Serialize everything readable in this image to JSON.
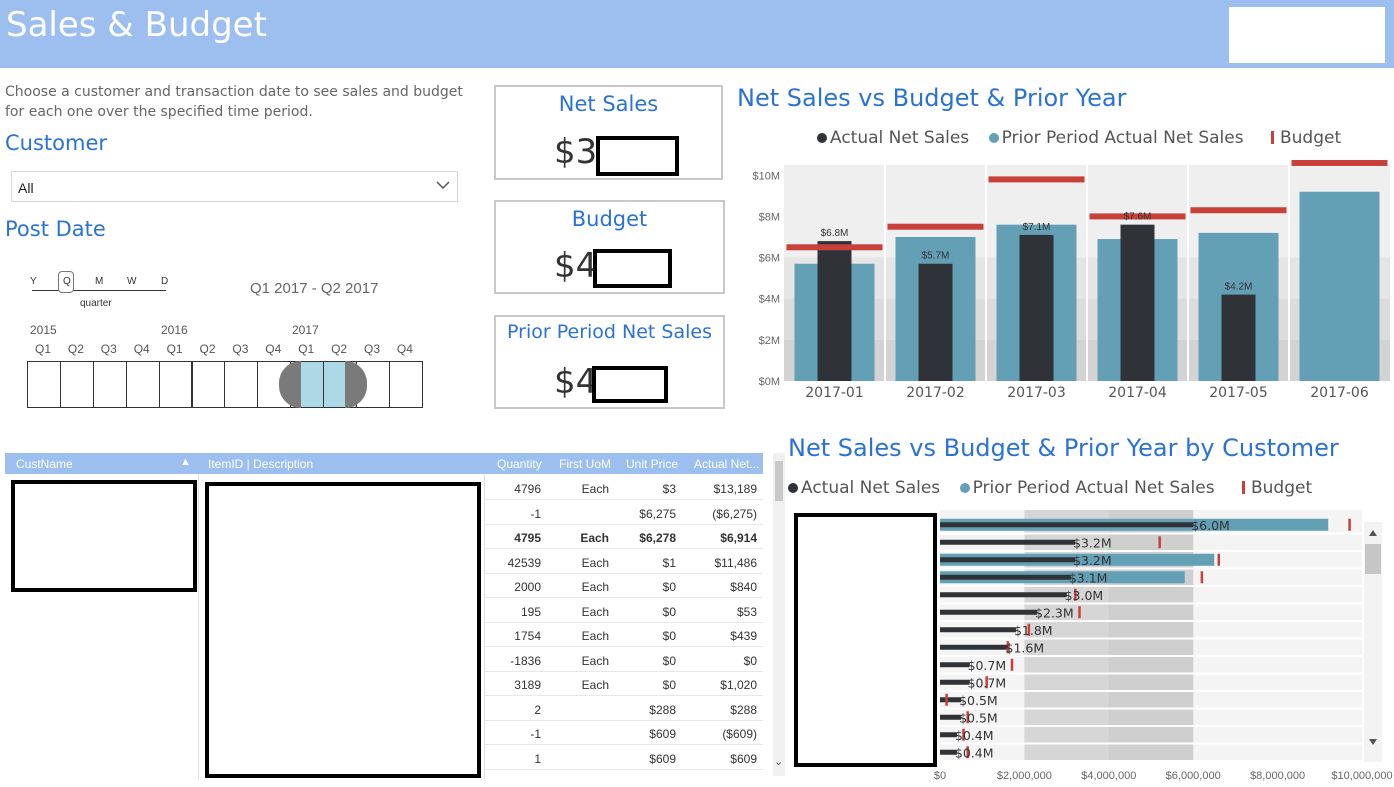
{
  "header": {
    "title": "Sales & Budget"
  },
  "intro": {
    "description": "Choose a customer and transaction date to see sales and budget for each one over the specified time period."
  },
  "customer_filter": {
    "label": "Customer",
    "value": "All"
  },
  "post_date": {
    "label": "Post Date",
    "granularity": [
      "Y",
      "Q",
      "M",
      "W",
      "D"
    ],
    "selected_granularity": "quarter",
    "range_text": "Q1 2017 - Q2 2017",
    "years": [
      "2015",
      "2016",
      "2017"
    ],
    "quarters": [
      "Q1",
      "Q2",
      "Q3",
      "Q4",
      "Q1",
      "Q2",
      "Q3",
      "Q4",
      "Q1",
      "Q2",
      "Q3",
      "Q4"
    ]
  },
  "cards": {
    "net_sales": {
      "title": "Net Sales",
      "value": "$3"
    },
    "budget": {
      "title": "Budget",
      "value": "$4"
    },
    "prior": {
      "title": "Prior Period Net Sales",
      "value": "$4"
    }
  },
  "colors": {
    "accent": "#2a72d6",
    "header": "#9dbfef",
    "actual": "#2f3237",
    "prior": "#63a0b6",
    "budget": "#c8403a"
  },
  "chart_data": [
    {
      "type": "bar",
      "title": "Net Sales vs Budget & Prior Year",
      "legend": [
        "Actual Net Sales",
        "Prior Period Actual Net Sales",
        "Budget"
      ],
      "categories": [
        "2017-01",
        "2017-02",
        "2017-03",
        "2017-04",
        "2017-05",
        "2017-06"
      ],
      "yticks": [
        "$0M",
        "$2M",
        "$4M",
        "$6M",
        "$8M",
        "$10M"
      ],
      "ylim": [
        0,
        10.5
      ],
      "series": [
        {
          "name": "Actual Net Sales",
          "values": [
            6.8,
            5.7,
            7.1,
            7.6,
            4.2,
            0
          ]
        },
        {
          "name": "Prior Period Actual Net Sales",
          "values": [
            5.7,
            7.0,
            7.6,
            6.9,
            7.2,
            9.2
          ]
        },
        {
          "name": "Budget",
          "values": [
            6.5,
            7.5,
            9.8,
            8.0,
            8.3,
            10.6
          ]
        }
      ],
      "data_labels": [
        "$6.8M",
        "$5.7M",
        "$7.1M",
        "$7.6M",
        "$4.2M",
        ""
      ]
    },
    {
      "type": "bar",
      "title": "Net Sales vs Budget & Prior Year by Customer",
      "legend": [
        "Actual Net Sales",
        "Prior Period Actual Net Sales",
        "Budget"
      ],
      "xticks": [
        "$0",
        "$2,000,000",
        "$4,000,000",
        "$6,000,000",
        "$8,000,000",
        "$10,000,000"
      ],
      "xlim": [
        0,
        10000000
      ],
      "series": [
        {
          "name": "Actual Net Sales",
          "values": [
            6000000,
            3200000,
            3200000,
            3100000,
            3000000,
            2300000,
            1800000,
            1600000,
            700000,
            700000,
            500000,
            500000,
            400000,
            400000
          ]
        },
        {
          "name": "Prior Period Actual Net Sales",
          "values": [
            9200000,
            0,
            6500000,
            5800000,
            0,
            0,
            0,
            0,
            0,
            0,
            0,
            0,
            0,
            0
          ]
        },
        {
          "name": "Budget",
          "values": [
            9700000,
            5200000,
            6600000,
            6200000,
            3200000,
            3300000,
            2100000,
            1600000,
            1700000,
            1100000,
            150000,
            650000,
            550000,
            650000
          ]
        }
      ],
      "data_labels": [
        "$6.0M",
        "$3.2M",
        "$3.2M",
        "$3.1M",
        "$3.0M",
        "$2.3M",
        "$1.8M",
        "$1.6M",
        "$0.7M",
        "$0.7M",
        "$0.5M",
        "$0.5M",
        "$0.4M",
        "$0.4M"
      ]
    }
  ],
  "table": {
    "columns": [
      "CustName",
      "ItemID | Description",
      "Quantity",
      "First UoM",
      "Unit Price",
      "Actual Net..."
    ],
    "rows": [
      {
        "qty": "4796",
        "uom": "Each",
        "price": "$3",
        "net": "$13,189"
      },
      {
        "qty": "-1",
        "uom": "",
        "price": "$6,275",
        "net": "($6,275)"
      },
      {
        "qty": "4795",
        "uom": "Each",
        "price": "$6,278",
        "net": "$6,914",
        "bold": true
      },
      {
        "qty": "42539",
        "uom": "Each",
        "price": "$1",
        "net": "$11,486"
      },
      {
        "qty": "2000",
        "uom": "Each",
        "price": "$0",
        "net": "$840"
      },
      {
        "qty": "195",
        "uom": "Each",
        "price": "$0",
        "net": "$53"
      },
      {
        "qty": "1754",
        "uom": "Each",
        "price": "$0",
        "net": "$439"
      },
      {
        "qty": "-1836",
        "uom": "Each",
        "price": "$0",
        "net": "$0"
      },
      {
        "qty": "3189",
        "uom": "Each",
        "price": "$0",
        "net": "$1,020"
      },
      {
        "qty": "2",
        "uom": "",
        "price": "$288",
        "net": "$288"
      },
      {
        "qty": "-1",
        "uom": "",
        "price": "$609",
        "net": "($609)"
      },
      {
        "qty": "1",
        "uom": "",
        "price": "$609",
        "net": "$609"
      }
    ]
  }
}
